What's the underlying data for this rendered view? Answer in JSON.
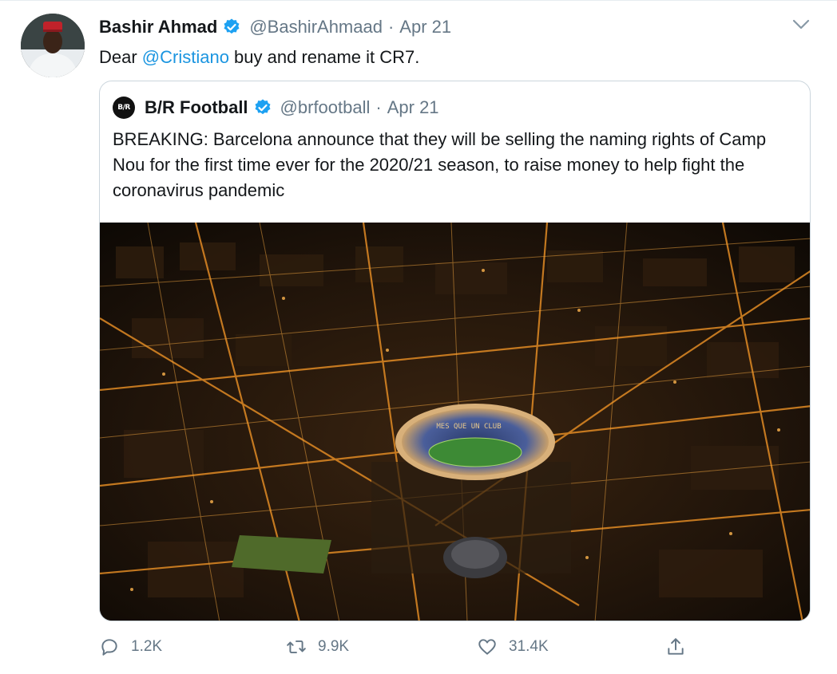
{
  "tweet": {
    "author_name": "Bashir Ahmad",
    "author_handle": "@BashirAhmaad",
    "separator": "·",
    "date": "Apr 21",
    "text_prefix": "Dear ",
    "mention": "@Cristiano",
    "text_suffix": " buy and rename it CR7."
  },
  "quoted": {
    "logo_text": "B/R",
    "author_name": "B/R Football",
    "author_handle": "@brfootball",
    "separator": "·",
    "date": "Apr 21",
    "text": "BREAKING: Barcelona announce that they will be selling the naming rights of Camp Nou for the first time ever for the 2020/21 season, to raise money to help fight the coronavirus pandemic",
    "stadium_sign": "MES QUE UN CLUB"
  },
  "actions": {
    "replies": "1.2K",
    "retweets": "9.9K",
    "likes": "31.4K"
  },
  "icons": {
    "verified": "verified-badge-icon",
    "more": "chevron-down-icon",
    "reply": "reply-icon",
    "retweet": "retweet-icon",
    "like": "heart-icon",
    "share": "share-icon"
  },
  "colors": {
    "link": "#1b95e0",
    "muted": "#657786",
    "verified": "#1da1f2",
    "border": "#ccd6dd"
  }
}
